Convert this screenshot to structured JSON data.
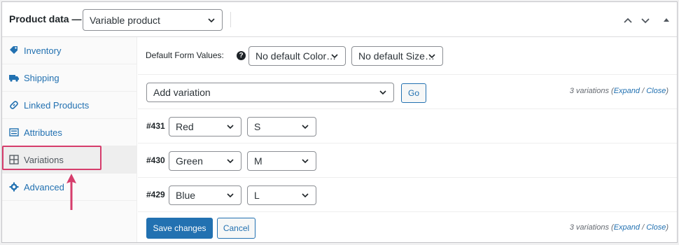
{
  "header": {
    "title": "Product data —",
    "product_type": "Variable product"
  },
  "sidebar": {
    "items": [
      {
        "label": "Inventory",
        "icon": "tag-icon"
      },
      {
        "label": "Shipping",
        "icon": "truck-icon"
      },
      {
        "label": "Linked Products",
        "icon": "link-icon"
      },
      {
        "label": "Attributes",
        "icon": "list-icon"
      },
      {
        "label": "Variations",
        "icon": "grid-icon"
      },
      {
        "label": "Advanced",
        "icon": "gear-icon"
      }
    ]
  },
  "defaults": {
    "label": "Default Form Values:",
    "color_select": "No default Color…",
    "size_select": "No default Size…"
  },
  "toolbar": {
    "add_variation": "Add variation",
    "go_label": "Go",
    "count_prefix": "3 variations (",
    "expand": "Expand",
    "sep": " / ",
    "close": "Close",
    "count_suffix": ")"
  },
  "variations": [
    {
      "id": "#431",
      "color": "Red",
      "size": "S"
    },
    {
      "id": "#430",
      "color": "Green",
      "size": "M"
    },
    {
      "id": "#429",
      "color": "Blue",
      "size": "L"
    }
  ],
  "footer": {
    "save_label": "Save changes",
    "cancel_label": "Cancel"
  },
  "colors": {
    "accent": "#2271b1",
    "highlight": "#d63d6c"
  }
}
